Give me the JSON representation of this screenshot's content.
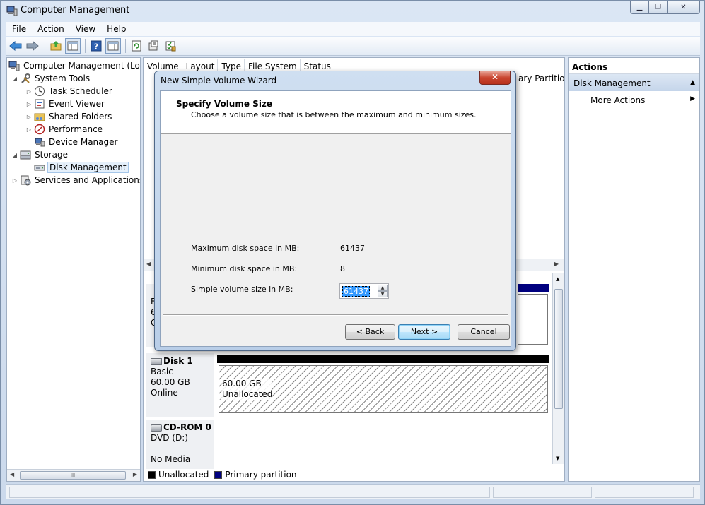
{
  "window": {
    "title": "Computer Management"
  },
  "menu": [
    "File",
    "Action",
    "View",
    "Help"
  ],
  "tree": {
    "root": "Computer Management (Local",
    "system_tools": "System Tools",
    "task_scheduler": "Task Scheduler",
    "event_viewer": "Event Viewer",
    "shared_folders": "Shared Folders",
    "performance": "Performance",
    "device_manager": "Device Manager",
    "storage": "Storage",
    "disk_management": "Disk Management",
    "services": "Services and Applications"
  },
  "columns": [
    "Volume",
    "Layout",
    "Type",
    "File System",
    "Status"
  ],
  "partial_col_text": "ary Partition",
  "disk_cutoff": {
    "b": "B",
    "six": "6(",
    "o": "O"
  },
  "disk1": {
    "name": "Disk 1",
    "type": "Basic",
    "size": "60.00 GB",
    "state": "Online",
    "part_size": "60.00 GB",
    "part_label": "Unallocated"
  },
  "cdrom": {
    "name": "CD-ROM 0",
    "drive": "DVD (D:)",
    "media": "No Media"
  },
  "legend": {
    "unallocated": "Unallocated",
    "primary": "Primary partition"
  },
  "legend_colors": {
    "unallocated": "#000000",
    "primary": "#00007f"
  },
  "actions": {
    "header": "Actions",
    "section": "Disk Management",
    "more": "More Actions"
  },
  "dialog": {
    "title": "New Simple Volume Wizard",
    "close": "✕",
    "heading": "Specify Volume Size",
    "subheading": "Choose a volume size that is between the maximum and minimum sizes.",
    "max_label": "Maximum disk space in MB:",
    "max_value": "61437",
    "min_label": "Minimum disk space in MB:",
    "min_value": "8",
    "size_label": "Simple volume size in MB:",
    "size_value": "61437",
    "back": "< Back",
    "next": "Next >",
    "cancel": "Cancel"
  }
}
